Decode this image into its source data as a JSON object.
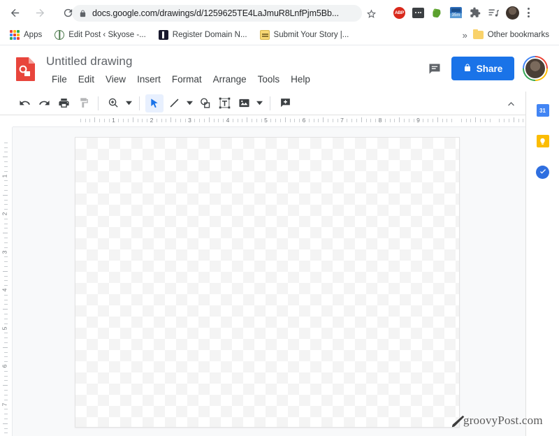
{
  "browser": {
    "nav": {
      "back_label": "Back",
      "forward_label": "Forward",
      "reload_label": "Reload"
    },
    "omnibox": {
      "url": "docs.google.com/drawings/d/1259625TE4LaJmuR8LnfPjm5Bb...",
      "lock_icon": "lock-icon",
      "star_icon": "bookmark-star-icon"
    },
    "extensions": [
      {
        "name": "adblock-plus",
        "label": "ABP"
      },
      {
        "name": "dark-extension",
        "label": ""
      },
      {
        "name": "evernote",
        "label": ""
      },
      {
        "name": "blue-timer-extension",
        "label": "35m"
      },
      {
        "name": "extensions-puzzle",
        "label": ""
      },
      {
        "name": "reading-list",
        "label": ""
      }
    ],
    "profile_label": "Profile",
    "menu_label": "Customize and control Google Chrome"
  },
  "bookmarks": {
    "apps_label": "Apps",
    "items": [
      {
        "label": "Edit Post ‹ Skyose -...",
        "icon": "globe-icon"
      },
      {
        "label": "Register Domain N...",
        "icon": "dark-square-icon"
      },
      {
        "label": "Submit Your Story |...",
        "icon": "note-icon"
      }
    ],
    "overflow_label": "»",
    "other_label": "Other bookmarks"
  },
  "app": {
    "logo_icon": "google-drawings-icon",
    "title": "Untitled drawing",
    "menus": [
      "File",
      "Edit",
      "View",
      "Insert",
      "Format",
      "Arrange",
      "Tools",
      "Help"
    ],
    "comment_icon": "comment-icon",
    "share_label": "Share",
    "share_lock_icon": "lock-icon",
    "share_color": "#1a73e8",
    "avatar_label": "Account"
  },
  "toolbar": {
    "items": [
      {
        "name": "undo-icon",
        "label": "Undo",
        "state": "enabled",
        "caret": false
      },
      {
        "name": "redo-icon",
        "label": "Redo",
        "state": "enabled",
        "caret": false
      },
      {
        "name": "print-icon",
        "label": "Print",
        "state": "enabled",
        "caret": false
      },
      {
        "name": "paint-format-icon",
        "label": "Paint format",
        "state": "disabled",
        "caret": false
      },
      {
        "name": "zoom-icon",
        "label": "Zoom",
        "state": "enabled",
        "caret": true
      },
      {
        "name": "select-cursor-icon",
        "label": "Select",
        "state": "selected",
        "caret": false
      },
      {
        "name": "line-icon",
        "label": "Line",
        "state": "enabled",
        "caret": true
      },
      {
        "name": "shape-icon",
        "label": "Shape",
        "state": "enabled",
        "caret": false
      },
      {
        "name": "text-box-icon",
        "label": "Text box",
        "state": "enabled",
        "caret": false
      },
      {
        "name": "image-icon",
        "label": "Image",
        "state": "enabled",
        "caret": true
      },
      {
        "name": "add-comment-icon",
        "label": "Comment",
        "state": "enabled",
        "caret": false
      }
    ],
    "collapse_icon": "chevron-up-icon"
  },
  "right_rail": {
    "items": [
      {
        "name": "google-calendar-icon",
        "label": "31",
        "color": "#4285f4"
      },
      {
        "name": "google-keep-icon",
        "label": "",
        "color": "#fbbc04"
      },
      {
        "name": "google-tasks-icon",
        "label": "",
        "color": "#2f6fe0"
      }
    ]
  },
  "workspace": {
    "ruler_h_numbers": [
      1,
      2,
      3,
      4,
      5,
      6,
      7,
      8,
      9
    ],
    "ruler_v_numbers": [
      1,
      2,
      3,
      4,
      5,
      6,
      7
    ],
    "canvas_label": "drawing-canvas",
    "canvas_state": "empty"
  },
  "watermark": {
    "text": "groovyPost.com"
  }
}
